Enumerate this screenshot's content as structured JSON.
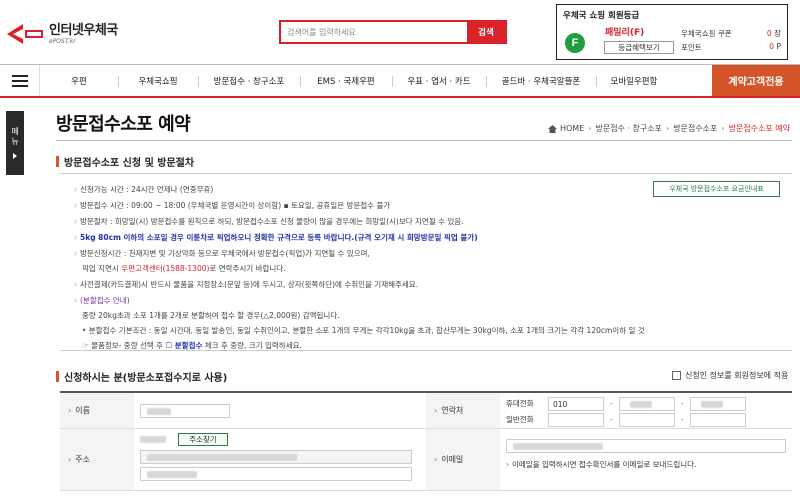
{
  "header": {
    "logo_ko": "인터넷우체국",
    "logo_en": "ePOST.kr",
    "search_placeholder": "검색어를 입력하세요",
    "search_button": "검색",
    "member": {
      "title": "우체국 쇼핑 회원등급",
      "badge": "F",
      "grade": "패밀리(F)",
      "grade_button": "등급혜택보기",
      "coupon_label": "우체국쇼핑 쿠폰",
      "coupon_value": "0",
      "coupon_unit": "장",
      "point_label": "포인트",
      "point_value": "0",
      "point_unit": "P"
    }
  },
  "nav": {
    "items": [
      "우편",
      "우체국쇼핑",
      "방문접수 · 창구소포",
      "EMS · 국제우편",
      "우표 · 엽서 · 카드",
      "골드바 · 우체국알뜰폰",
      "모바일우편함"
    ],
    "cta": "계약고객전용"
  },
  "sidetab": {
    "line1": "메",
    "line2": "뉴"
  },
  "page": {
    "title": "방문접수소포 예약",
    "breadcrumb": [
      "HOME",
      "방문접수 · 창구소포",
      "방문접수소포",
      "방문접수소포 예약"
    ]
  },
  "info": {
    "section_title": "방문접수소포 신청 및 방문절차",
    "fee_button": "우체국 방문접수소포 요금안내표",
    "l1": "신청가능 시간 : 24시간 언제나 (연중무휴)",
    "l2": "방문접수 시간 : 09:00 ~ 18:00 (우체국별 운영시간이 상이함) ▪ 토요일, 공휴일은 방문접수 불가",
    "l3": "방문절차 : 희망일(시) 방문접수를 원칙으로 하되, 방문접수소포 신청 물량이 많을 경우에는 희망일(시)보다 지연될 수 있음.",
    "l4": "5kg 80cm 이하의 소포일 경우 이륜차로 픽업하오니 정확한 규격으로 등록 바랍니다.(규격 오기재 시 희망방문일 픽업 불가)",
    "l5": "방문신청시간 : 천재지변 및 기상악화 등으로 우체국에서 방문접수(픽업)가 지연될 수 있으며,",
    "l6_a": "픽업 지연시 ",
    "l6_b": "우편고객센터(1588-1300)",
    "l6_c": "로 연락주시기 바랍니다.",
    "l7": "사전결제(카드결제)시 반드시 물품을 지정장소(문앞 등)에 두시고, 상자(윗쪽하단)에 수취인을 기재해주세요.",
    "l8": "(분할접수 안내)",
    "l9": "중량 20kg초과 소포 1개를 2개로 분할하여 접수 할 경우(△2,000원) 감액됩니다.",
    "l10": "• 분할접수 기본조건 : 동일 시간대, 동일 발송인, 동일 수취인이고, 분할한 소포 1개의 무게는 각각10kg을 초과, 합산무게는 30kg이하, 소포 1개의 크기는 각각 120cm이하 일 것",
    "l11_a": "☞ 물품정보- 중량 선택 후 ",
    "l11_b": "☐ 분할접수",
    "l11_c": " 체크 후 중량, 크기 입력하세요."
  },
  "form": {
    "section_title": "신청하시는 분(방문소포접수지로 사용)",
    "same_info_label": "신청인 정보를 회원정보에 적용",
    "name_label": "이름",
    "contact_label": "연락처",
    "mobile_label": "휴대전화",
    "mobile_prefix": "010",
    "phone_label": "일반전화",
    "address_label": "주소",
    "zip_button": "주소찾기",
    "email_label": "이메일",
    "email_note": "이메일을 입력하시면 접수확인서를 이메일로 보내드립니다.",
    "dash": "-"
  },
  "colors": {
    "brand_red": "#d92329",
    "cta_orange": "#d6542a",
    "badge_green": "#1f9d3f",
    "text_blue": "#2233aa"
  }
}
